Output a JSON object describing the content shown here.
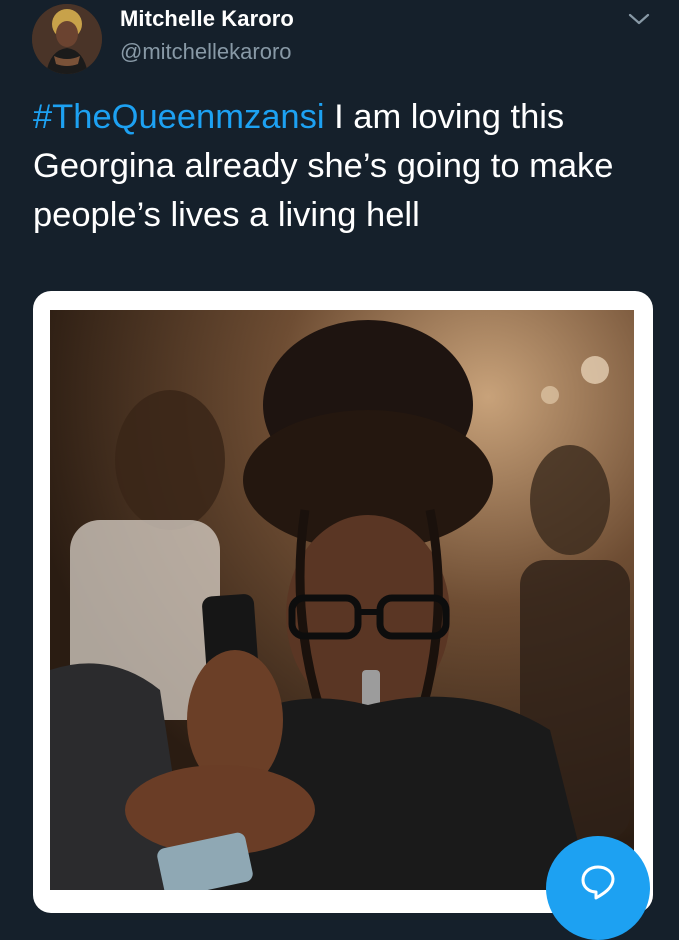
{
  "tweet": {
    "author_name": "Mitchelle Karoro",
    "author_handle": "@mitchellekaroro",
    "hashtag": "#TheQueenmzansi",
    "text_body": " I am loving this Georgina already she’s going to make people’s lives a living hell"
  },
  "icons": {
    "menu": "chevron-down-icon",
    "compose": "speech-bubble-icon"
  },
  "colors": {
    "background": "#15202b",
    "accent": "#1da1f2",
    "secondary_text": "#8899a6"
  }
}
